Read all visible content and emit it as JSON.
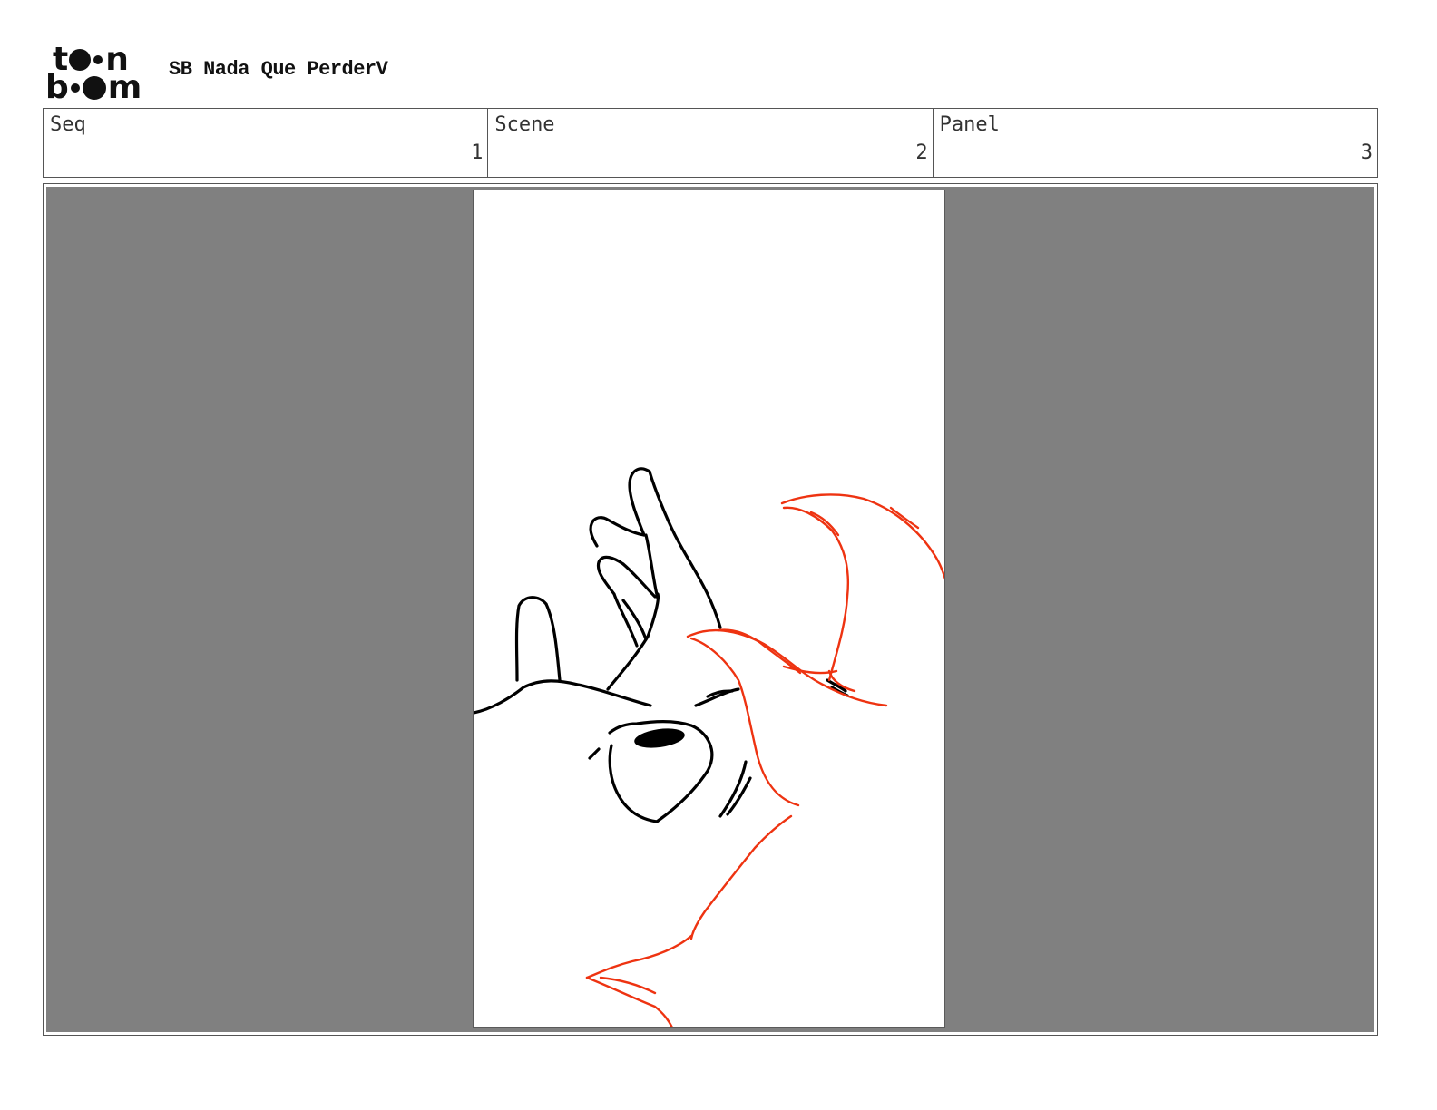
{
  "header": {
    "title": "SB Nada Que PerderV"
  },
  "info": [
    {
      "label": "Seq",
      "value": "1"
    },
    {
      "label": "Scene",
      "value": "2"
    },
    {
      "label": "Panel",
      "value": "3"
    }
  ],
  "colors": {
    "frame_background": "#808080",
    "sketch_black": "#000000",
    "sketch_red": "#ee3311"
  }
}
